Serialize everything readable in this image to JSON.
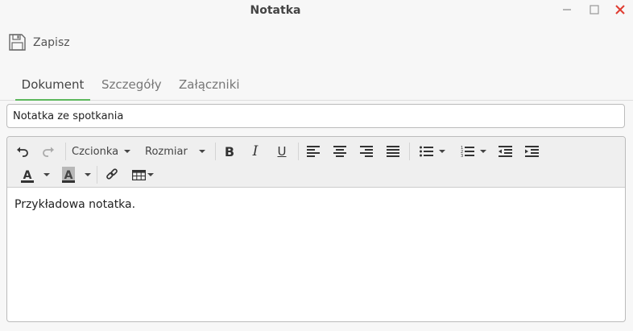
{
  "window": {
    "title": "Notatka"
  },
  "toolbar": {
    "save_label": "Zapisz"
  },
  "tabs": [
    {
      "label": "Dokument",
      "active": true
    },
    {
      "label": "Szczegóły",
      "active": false
    },
    {
      "label": "Załączniki",
      "active": false
    }
  ],
  "form": {
    "title_value": "Notatka ze spotkania"
  },
  "editor": {
    "font_label": "Czcionka",
    "size_label": "Rozmiar",
    "bold_label": "B",
    "italic_label": "I",
    "underline_label": "U",
    "text_color_label": "A",
    "bg_color_label": "A",
    "content": "Przykładowa notatka."
  },
  "colors": {
    "accent": "#5cb85c",
    "close": "#e03c31"
  }
}
